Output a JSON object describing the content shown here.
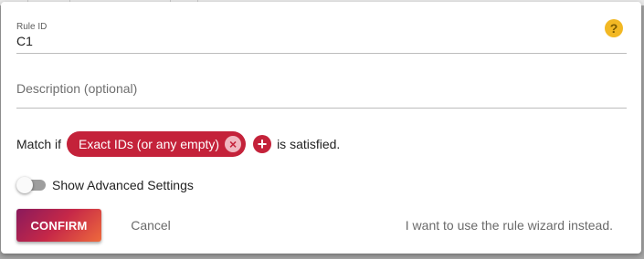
{
  "dialog": {
    "rule_id": {
      "label": "Rule ID",
      "value": "C1"
    },
    "help_icon": "?",
    "description": {
      "placeholder": "Description (optional)",
      "value": ""
    },
    "match": {
      "prefix": "Match if",
      "chip_label": "Exact IDs (or any empty)",
      "chip_remove_icon": "×",
      "add_icon": "+",
      "suffix": "is satisfied."
    },
    "advanced_toggle": {
      "label": "Show Advanced Settings",
      "checked": false
    },
    "buttons": {
      "confirm": "CONFIRM",
      "cancel": "Cancel",
      "wizard": "I want to use the rule wizard instead."
    }
  },
  "colors": {
    "accent": "#c4223a",
    "help": "#f2b824",
    "confirm_gradient": [
      "#8a1a5c",
      "#c62848",
      "#ee6a3c"
    ]
  },
  "icons": {
    "help": "question-circle-icon",
    "chip_remove": "close-circle-icon",
    "add": "add-circle-icon"
  }
}
